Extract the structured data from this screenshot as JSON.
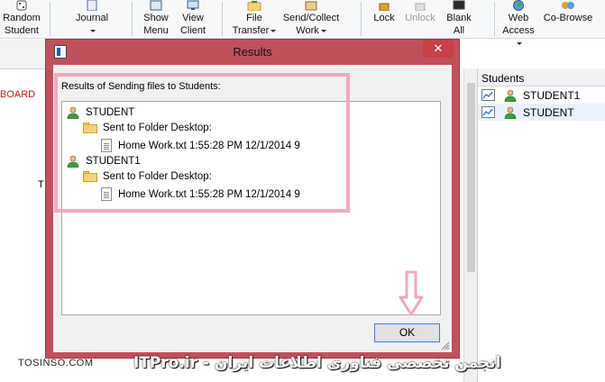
{
  "ribbon": {
    "random_student": [
      "Random",
      "Student"
    ],
    "journal": "Journal",
    "show_menu": [
      "Show",
      "Menu"
    ],
    "view_client": [
      "View",
      "Client"
    ],
    "file_transfer": [
      "File",
      "Transfer"
    ],
    "send_collect": [
      "Send/Collect",
      "Work"
    ],
    "lock": "Lock",
    "unlock": "Unlock",
    "blank_all": [
      "Blank",
      "All"
    ],
    "web_access": [
      "Web",
      "Access"
    ],
    "co_browse": "Co-Browse"
  },
  "background": {
    "board_fragment": "BOARD",
    "t_fragment": "T"
  },
  "students_panel": {
    "header": "Students",
    "items": [
      {
        "name": "STUDENT1"
      },
      {
        "name": "STUDENT"
      }
    ]
  },
  "dialog": {
    "title": "Results",
    "close_glyph": "✕",
    "label": "Results of Sending files to Students:",
    "tree": {
      "s1_name": "STUDENT",
      "s1_action": "Sent to Folder Desktop:",
      "s1_file": "Home Work.txt 1:55:28 PM 12/1/2014 9",
      "s2_name": "STUDENT1",
      "s2_action": "Sent to Folder Desktop:",
      "s2_file": "Home Work.txt 1:55:28 PM 12/1/2014 9"
    },
    "ok_label": "OK"
  },
  "watermark": {
    "left": "TOSINSO.COM",
    "right": "انجمن تخصصی فناوری اطلاعات ایران - ITPro.ir"
  },
  "colors": {
    "dialog_frame": "#c0505c",
    "highlight": "#f0a8c0",
    "close_button": "#c84048",
    "ok_border": "#3c7fd1"
  }
}
